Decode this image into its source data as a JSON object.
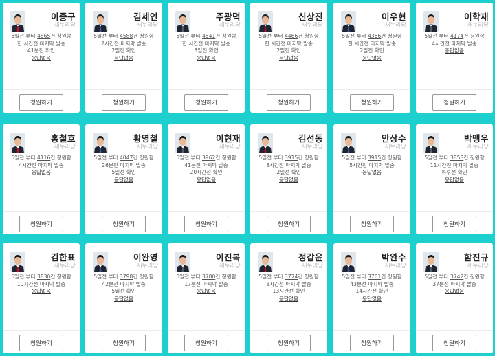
{
  "labels": {
    "prefix": "5일전 부터",
    "suffix": "건 청원함",
    "last_action": "마지막 발송",
    "confirm": "확인",
    "no_response": "응답없음",
    "petition_button": "청원하기",
    "party": "새누리당"
  },
  "theme": {
    "background": "#1ecfcf",
    "card": "#ffffff",
    "tie_colors": [
      "#c8102e",
      "#3a5ba9",
      "#555f6b"
    ]
  },
  "cards": [
    {
      "name": "이종구",
      "party": "새누리당",
      "count": "4865",
      "status": [
        "한 시간전 마지막 발송",
        "41분전 확인"
      ],
      "response": "응답없음",
      "button": "청원하기"
    },
    {
      "name": "김세연",
      "party": "새누리당",
      "count": "4588",
      "status": [
        "2시간전 마지막 발송",
        "2일전 확인"
      ],
      "response": "응답없음",
      "button": "청원하기"
    },
    {
      "name": "주광덕",
      "party": "새누리당",
      "count": "4541",
      "status": [
        "한 시간전 마지막 발송",
        "5일전 확인"
      ],
      "response": "응답없음",
      "button": "청원하기"
    },
    {
      "name": "신상진",
      "party": "새누리당",
      "count": "4466",
      "status": [
        "한 시간전 마지막 발송",
        "2일전 확인"
      ],
      "response": "응답없음",
      "button": "청원하기"
    },
    {
      "name": "이우현",
      "party": "새누리당",
      "count": "4366",
      "status": [
        "한 시간전 마지막 발송",
        "2일전 확인"
      ],
      "response": "응답없음",
      "button": "청원하기"
    },
    {
      "name": "이학재",
      "party": "새누리당",
      "count": "4174",
      "status": [
        "4시간전 마지막 발송"
      ],
      "response": "응답없음",
      "button": "청원하기"
    },
    {
      "name": "홍철호",
      "party": "새누리당",
      "count": "4116",
      "status": [
        "4시간전 마지막 발송"
      ],
      "response": "응답없음",
      "button": "청원하기"
    },
    {
      "name": "황영철",
      "party": "새누리당",
      "count": "4047",
      "status": [
        "26분전 마지막 발송",
        "5일전 확인"
      ],
      "response": "응답없음",
      "button": "청원하기"
    },
    {
      "name": "이현재",
      "party": "새누리당",
      "count": "3962",
      "status": [
        "41분전 마지막 발송",
        "20시간전 확인"
      ],
      "response": "응답없음",
      "button": "청원하기"
    },
    {
      "name": "김선동",
      "party": "새누리당",
      "count": "3915",
      "status": [
        "8시간전 마지막 발송",
        "2일전 확인"
      ],
      "response": "응답없음",
      "button": "청원하기"
    },
    {
      "name": "안상수",
      "party": "새누리당",
      "count": "3915",
      "status": [
        "5시간전 마지막 발송"
      ],
      "response": "응답없음",
      "button": "청원하기"
    },
    {
      "name": "박맹우",
      "party": "새누리당",
      "count": "3858",
      "status": [
        "11시간전 마지막 발송",
        "하루전 확인"
      ],
      "response": "응답없음",
      "button": "청원하기"
    },
    {
      "name": "김한표",
      "party": "새누리당",
      "count": "3830",
      "status": [
        "10시간전 마지막 발송"
      ],
      "response": "응답없음",
      "button": "청원하기"
    },
    {
      "name": "이완영",
      "party": "새누리당",
      "count": "3798",
      "status": [
        "42분전 마지막 발송",
        "5일전 확인"
      ],
      "response": "응답없음",
      "button": "청원하기"
    },
    {
      "name": "이진복",
      "party": "새누리당",
      "count": "3780",
      "status": [
        "17분전 마지막 발송"
      ],
      "response": "응답없음",
      "button": "청원하기"
    },
    {
      "name": "정갑윤",
      "party": "새누리당",
      "count": "3774",
      "status": [
        "8시간전 마지막 발송",
        "13시간전 확인"
      ],
      "response": "응답없음",
      "button": "청원하기"
    },
    {
      "name": "박완수",
      "party": "새누리당",
      "count": "3761",
      "status": [
        "43분전 마지막 발송",
        "14시간전 확인"
      ],
      "response": "응답없음",
      "button": "청원하기"
    },
    {
      "name": "함진규",
      "party": "새누리당",
      "count": "3742",
      "status": [
        "37분전 마지막 발송"
      ],
      "response": "응답없음",
      "button": "청원하기"
    }
  ]
}
